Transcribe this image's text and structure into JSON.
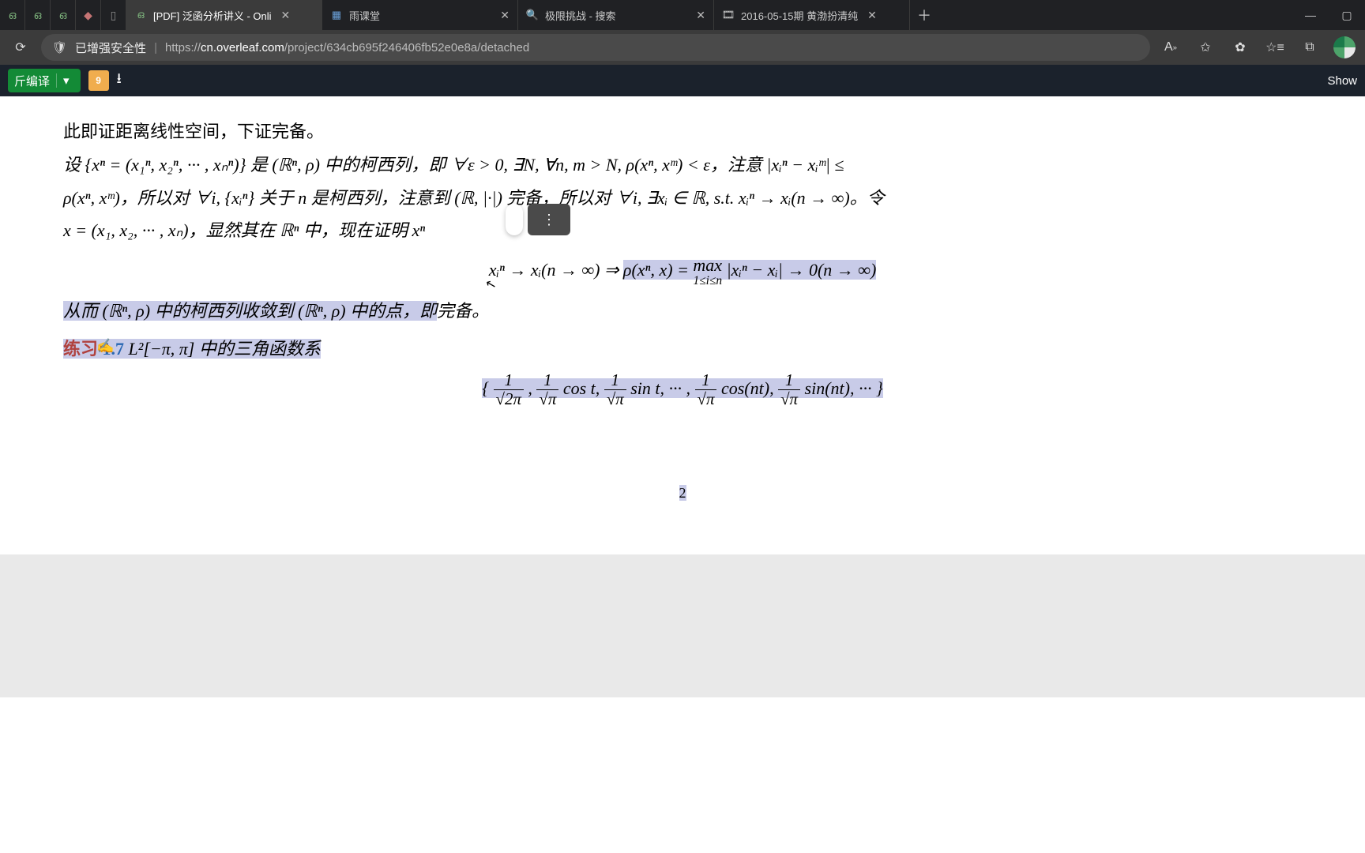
{
  "tabs": {
    "t0": {
      "title": "[PDF] 泛函分析讲义 - Onli"
    },
    "t1": {
      "title": "雨课堂"
    },
    "t2": {
      "title": "极限挑战 - 搜索"
    },
    "t3": {
      "title": "2016-05-15期 黄渤扮清纯"
    }
  },
  "address": {
    "security_label": "已增强安全性",
    "url_host_prefix": "https://",
    "url_host": "cn.overleaf.com",
    "url_path": "/project/634cb695f246406fb52e0e8a/detached"
  },
  "overleaf": {
    "compile_label": "斤编译",
    "notif_badge": "9",
    "show_label": "Show"
  },
  "doc": {
    "line1": "此即证距离线性空间，下证完备。",
    "line2_a": "设 {xⁿ = (x₁ⁿ, x₂ⁿ, ··· , xₙⁿ)} 是 (ℝⁿ, ρ) 中的柯西列，即 ∀ε > 0, ∃N, ∀n, m > N, ρ(xⁿ, xᵐ) < ε，注意 |xᵢⁿ − xᵢᵐ| ≤",
    "line2_b": "ρ(xⁿ, xᵐ)，所以对 ∀i, {xᵢⁿ} 关于 n 是柯西列，注意到 (ℝ, |·|) 完备，所以对 ∀i, ∃xᵢ ∈ ℝ, s.t. xᵢⁿ → xᵢ(n → ∞)。令",
    "line2_c_prefix": "x = (x₁, x₂, ··· , xₙ)，显然其在 ℝⁿ 中，现在证明 xⁿ ",
    "eq_left": "xᵢⁿ → xᵢ(n → ∞) ⇒ ",
    "eq_hl_a": "ρ(xⁿ, x) = ",
    "eq_max_top": "max",
    "eq_max_bot": "1≤i≤n",
    "eq_hl_b": " |xᵢⁿ − xᵢ| → 0(n → ∞)",
    "line3": "从而 (ℝⁿ, ρ) 中的柯西列收敛到 (ℝⁿ, ρ) 中的点，即",
    "line3_tail": "完备。",
    "exercise_label": "练习",
    "exercise_num": "1.7",
    "exercise_text": " L²[−π, π] 中的三角函数系",
    "trig_open": "{",
    "trig_f1_num": "1",
    "trig_f1_den": "√2π",
    "trig_c1": ", ",
    "trig_f2_num": "1",
    "trig_f2_den": "√π",
    "trig_t2": " cos t, ",
    "trig_f3_num": "1",
    "trig_f3_den": "√π",
    "trig_t3": " sin t, ··· , ",
    "trig_f4_num": "1",
    "trig_f4_den": "√π",
    "trig_t4": " cos(nt), ",
    "trig_f5_num": "1",
    "trig_f5_den": "√π",
    "trig_t5": " sin(nt), ··· }",
    "page_number": "2"
  }
}
